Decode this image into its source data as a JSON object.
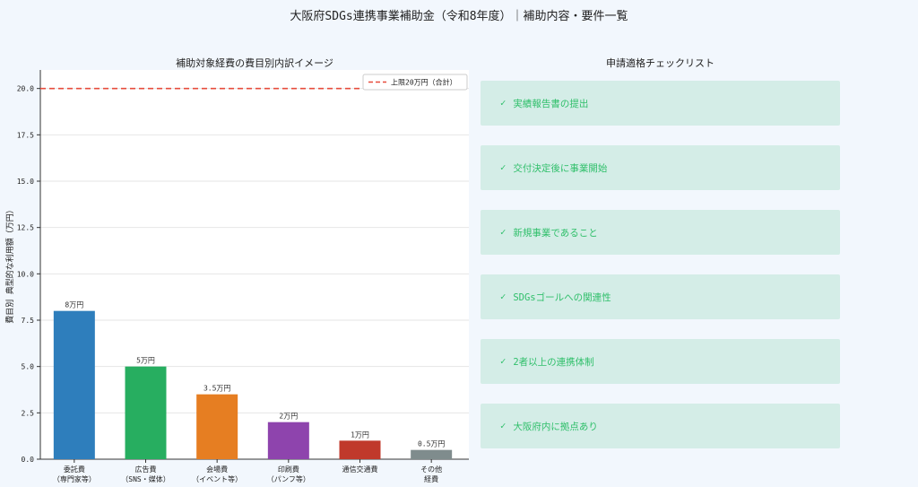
{
  "page": {
    "title": "大阪府SDGs連携事業補助金（令和8年度）｜補助内容・要件一覧"
  },
  "chart_data": {
    "type": "bar",
    "title": "補助対象経費の費目別内訳イメージ",
    "ylabel": "費目別 典型的な利用額（万円）",
    "xlabel": "",
    "ylim": [
      0,
      21
    ],
    "yticks": [
      0.0,
      2.5,
      5.0,
      7.5,
      10.0,
      12.5,
      15.0,
      17.5,
      20.0
    ],
    "ytick_labels": [
      "0.0",
      "2.5",
      "5.0",
      "7.5",
      "10.0",
      "12.5",
      "15.0",
      "17.5",
      "20.0"
    ],
    "grid": true,
    "legend": "top-right",
    "categories": [
      "委託費\n（専門家等）",
      "広告費\n（SNS・媒体）",
      "会場費\n（イベント等）",
      "印刷費\n（パンフ等）",
      "通信交通費",
      "その他\n経費"
    ],
    "values": [
      8,
      5,
      3.5,
      2,
      1,
      0.5
    ],
    "value_labels": [
      "8万円",
      "5万円",
      "3.5万円",
      "2万円",
      "1万円",
      "0.5万円"
    ],
    "colors": [
      "#2e7ebc",
      "#27ae60",
      "#e67e22",
      "#8e44ad",
      "#c0392b",
      "#7f8c8d"
    ],
    "reference_line": {
      "value": 20,
      "label": "上限20万円（合計）",
      "color": "#e74c3c"
    }
  },
  "checklist": {
    "title": "申請適格チェックリスト",
    "check_symbol": "✓",
    "items": [
      "実績報告書の提出",
      "交付決定後に事業開始",
      "新規事業であること",
      "SDGsゴールへの関連性",
      "2者以上の連携体制",
      "大阪府内に拠点あり"
    ]
  }
}
